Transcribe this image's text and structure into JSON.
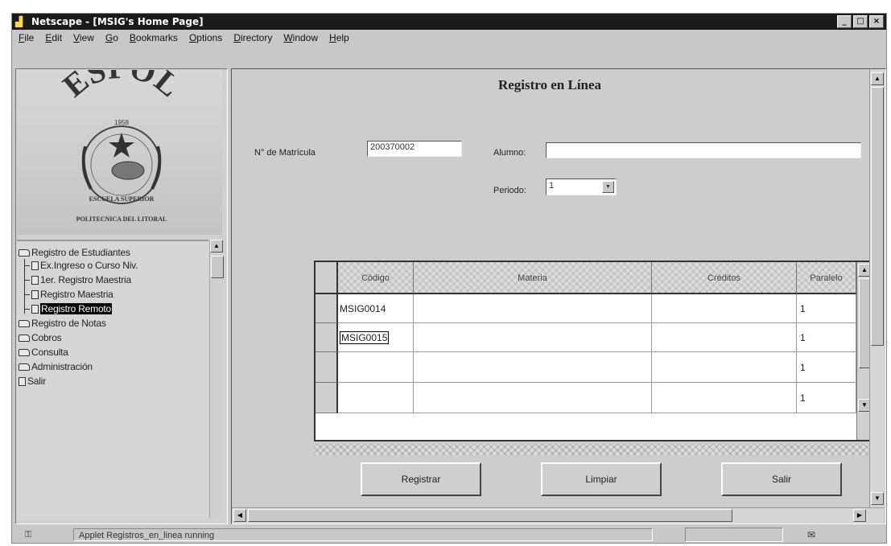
{
  "window": {
    "title": "Netscape - [MSIG's Home Page]",
    "controls": [
      "_",
      "□",
      "×"
    ]
  },
  "menu": [
    "File",
    "Edit",
    "View",
    "Go",
    "Bookmarks",
    "Options",
    "Directory",
    "Window",
    "Help"
  ],
  "logo": {
    "text": "ESPOL",
    "year": "1958",
    "motto": "ESCUELA SUPERIOR",
    "institution": "POLITECNICA DEL LITORAL"
  },
  "tree": {
    "root": "Registro de Estudiantes",
    "children": [
      "Ex.Ingreso o Curso Niv.",
      "1er. Registro Maestria",
      "Registro Maestria",
      "Registro Remoto"
    ],
    "selected": "Registro Remoto",
    "others": [
      "Registro de Notas",
      "Cobros",
      "Consulta",
      "Administración"
    ],
    "exit": "Salir"
  },
  "form": {
    "title": "Registro en Línea",
    "matricula_label": "N° de Matrícula",
    "matricula_value": "200370002",
    "alumno_label": "Alumno:",
    "alumno_value": "",
    "periodo_label": "Periodo:",
    "periodo_value": "1"
  },
  "grid": {
    "columns": [
      "Código",
      "Materia",
      "Créditos",
      "Paralelo"
    ],
    "rows": [
      {
        "codigo": "MSIG0014",
        "materia": "",
        "creditos": "",
        "paralelo": "1"
      },
      {
        "codigo": "MSIG0015",
        "materia": "",
        "creditos": "",
        "paralelo": "1"
      },
      {
        "codigo": "",
        "materia": "",
        "creditos": "",
        "paralelo": "1"
      },
      {
        "codigo": "",
        "materia": "",
        "creditos": "",
        "paralelo": "1"
      }
    ]
  },
  "buttons": {
    "register": "Registrar",
    "clear": "Limpiar",
    "exit": "Salir"
  },
  "status": {
    "text": "Applet Registros_en_linea running"
  },
  "icons": [
    "app-icon",
    "folder-icon",
    "document-icon",
    "scroll-up-icon",
    "scroll-down-icon",
    "dropdown-arrow-icon",
    "mail-icon",
    "security-key-icon"
  ]
}
